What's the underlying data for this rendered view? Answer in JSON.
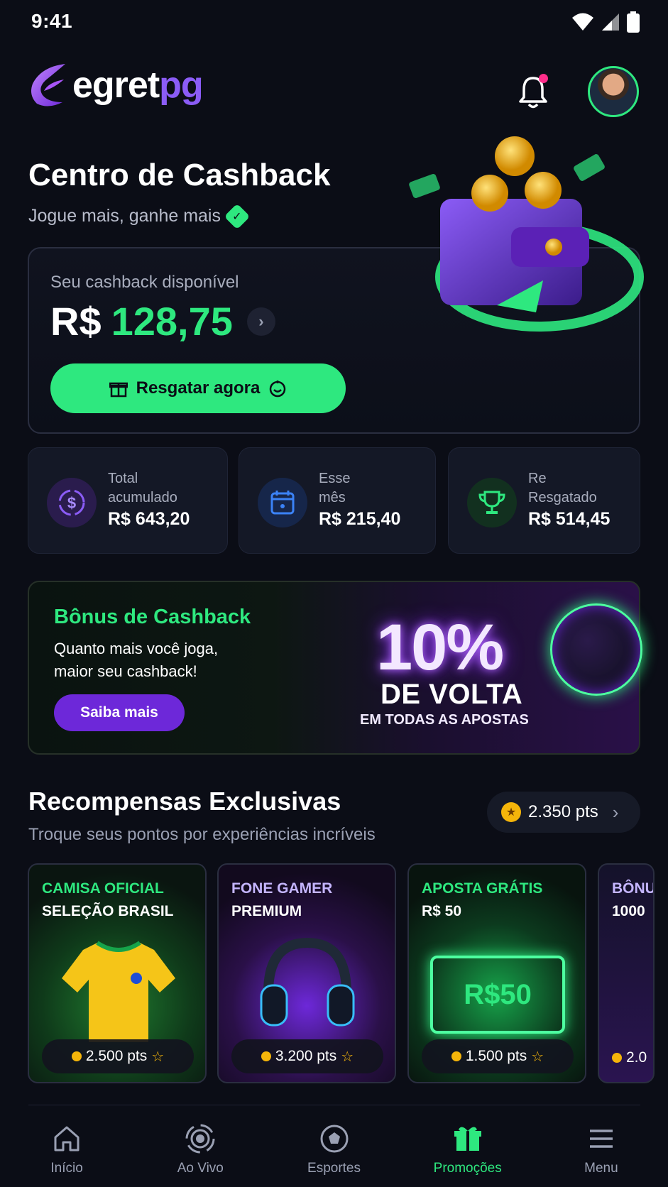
{
  "status_bar": {
    "time": "9:41"
  },
  "header": {
    "logo_main": "egret",
    "logo_accent": "pg"
  },
  "hero": {
    "title": "Centro de Cashback",
    "subtitle": "Jogue mais, ganhe mais",
    "available_label": "Seu cashback disponível",
    "currency": "R$",
    "amount": "128,75",
    "redeem_label": "Resgatar agora"
  },
  "stats": [
    {
      "label_line1": "Total",
      "label_line2": "acumulado",
      "value": "R$ 643,20",
      "icon": "dollar-cycle-icon"
    },
    {
      "label_line1": "Esse",
      "label_line2": "mês",
      "value": "R$ 215,40",
      "icon": "calendar-icon"
    },
    {
      "label_line1": "Re",
      "label_line2": "Resgatado",
      "value": "R$ 514,45",
      "icon": "trophy-icon"
    }
  ],
  "bonus": {
    "title": "Bônus de Cashback",
    "description": "Quanto mais você joga, maior seu cashback!",
    "button": "Saiba mais",
    "promo_percent": "10%",
    "promo_line1": "DE VOLTA",
    "promo_line2": "EM TODAS AS APOSTAS"
  },
  "rewards": {
    "title": "Recompensas Exclusivas",
    "subtitle": "Troque seus pontos por experiências incríveis",
    "points_balance": "2.350 pts",
    "items": [
      {
        "line1": "CAMISA OFICIAL",
        "line2": "SELEÇÃO BRASIL",
        "points": "2.500 pts"
      },
      {
        "line1": "FONE GAMER",
        "line2": "PREMIUM",
        "points": "3.200 pts"
      },
      {
        "line1": "APOSTA GRÁTIS",
        "line2": "R$ 50",
        "points": "1.500 pts",
        "ticket_text": "R$50"
      },
      {
        "line1": "BÔNUS",
        "line2": "1000",
        "points": "2.0"
      }
    ]
  },
  "nav": [
    {
      "label": "Início",
      "icon": "home-icon"
    },
    {
      "label": "Ao Vivo",
      "icon": "live-icon"
    },
    {
      "label": "Esportes",
      "icon": "soccer-ball-icon"
    },
    {
      "label": "Promoções",
      "icon": "gift-icon",
      "active": true
    },
    {
      "label": "Menu",
      "icon": "menu-icon"
    }
  ],
  "colors": {
    "accent_green": "#2ee87f",
    "accent_purple": "#6d28d9",
    "background": "#0b0d16"
  }
}
